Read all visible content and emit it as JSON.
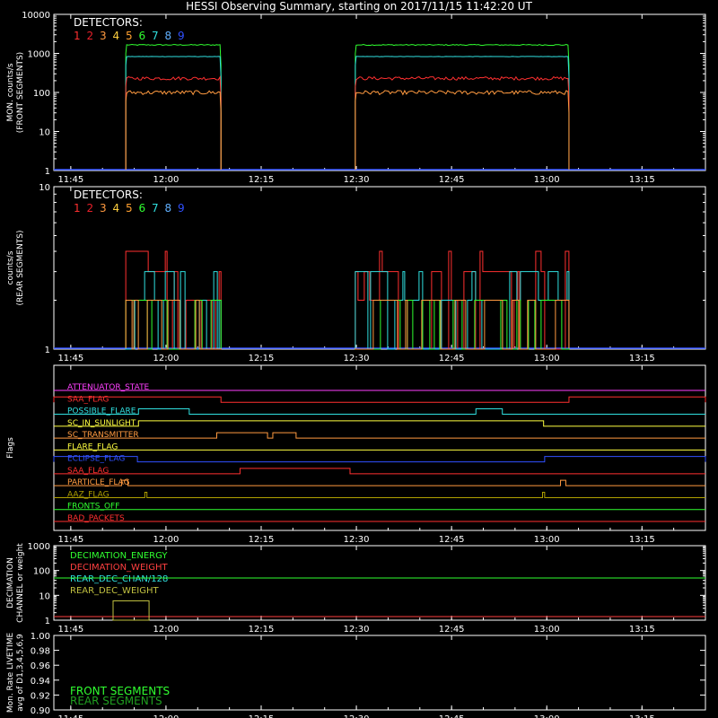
{
  "chart_data": {
    "title": "HESSI Observing Summary, starting on 2017/11/15 11:42:20 UT",
    "time_range": [
      "11:42:20",
      "13:25:00"
    ],
    "time_ticks": [
      "11:45",
      "12:00",
      "12:15",
      "12:30",
      "12:45",
      "13:00",
      "13:15"
    ],
    "detector_colors": [
      "#ff3030",
      "#e8202a",
      "#ff9a40",
      "#ffd040",
      "#ffa030",
      "#30ff30",
      "#30e0e0",
      "#60b0ff",
      "#3050ff"
    ],
    "panels": [
      {
        "id": "front",
        "type": "line",
        "ylabel": "MON. counts/s\n(FRONT SEGMENTS)",
        "log": true,
        "ylim": [
          1,
          10000
        ],
        "ytick_labels": [
          "1",
          "10",
          "100",
          "1000",
          "10000"
        ],
        "legend_title": "DETECTORS:",
        "legend_digits": [
          "1",
          "2",
          "3",
          "4",
          "5",
          "6",
          "7",
          "8",
          "9"
        ],
        "series": [
          {
            "color": "#30ff30",
            "base": 1650,
            "noise": 0.03,
            "segments": [
              [
                "11:53:40",
                "12:08:40"
              ],
              [
                "12:29:50",
                "13:03:30"
              ]
            ]
          },
          {
            "color": "#30e0e0",
            "base": 830,
            "noise": 0.01,
            "segments": [
              [
                "11:53:40",
                "12:08:40"
              ],
              [
                "12:29:50",
                "13:03:30"
              ]
            ]
          },
          {
            "color": "#ff3030",
            "base": 230,
            "noise": 0.1,
            "segments": [
              [
                "11:53:40",
                "12:08:40"
              ],
              [
                "12:29:50",
                "13:03:30"
              ]
            ]
          },
          {
            "color": "#ff9a40",
            "base": 100,
            "noise": 0.12,
            "segments": [
              [
                "11:53:40",
                "12:08:40"
              ],
              [
                "12:29:50",
                "13:03:30"
              ]
            ]
          }
        ]
      },
      {
        "id": "rear",
        "type": "step",
        "ylabel": "counts/s\n(REAR SEGMENTS)",
        "log": true,
        "ylim": [
          1,
          10
        ],
        "ytick_labels": [
          "1",
          "10"
        ],
        "legend_title": "DETECTORS:",
        "legend_digits": [
          "1",
          "2",
          "3",
          "4",
          "5",
          "6",
          "7",
          "8",
          "9"
        ],
        "series": [
          {
            "color": "#ff3030",
            "levels": [
              1,
              2,
              3,
              4
            ],
            "segments": [
              [
                "11:53:40",
                "12:08:40"
              ],
              [
                "12:29:50",
                "13:03:30"
              ]
            ]
          },
          {
            "color": "#30e0e0",
            "levels": [
              1,
              2,
              3
            ],
            "segments": [
              [
                "11:53:40",
                "12:08:40"
              ],
              [
                "12:29:50",
                "13:03:30"
              ]
            ]
          },
          {
            "color": "#30ff30",
            "levels": [
              1,
              2
            ],
            "segments": [
              [
                "11:53:40",
                "12:08:40"
              ],
              [
                "12:29:50",
                "13:03:30"
              ]
            ]
          },
          {
            "color": "#ff9a40",
            "levels": [
              1,
              2
            ],
            "segments": [
              [
                "11:53:40",
                "12:08:40"
              ],
              [
                "12:29:50",
                "13:03:30"
              ]
            ]
          }
        ]
      },
      {
        "id": "flags",
        "type": "flags",
        "ylabel": "Flags",
        "flags": [
          {
            "name": "ATTENUATOR_STATE",
            "color": "#ff40ff",
            "on": []
          },
          {
            "name": "SAA_FLAG",
            "color": "#ff3030",
            "on": [
              [
                "11:42:20",
                "12:08:40"
              ],
              [
                "13:03:30",
                "13:25:00"
              ]
            ]
          },
          {
            "name": "POSSIBLE_FLARE",
            "color": "#30e0e0",
            "on": [
              [
                "11:55:40",
                "12:03:40"
              ],
              [
                "12:48:50",
                "12:53:00"
              ]
            ]
          },
          {
            "name": "SC_IN_SUNLIGHT",
            "color": "#ffff40",
            "on": [
              [
                "11:55:40",
                "12:59:30"
              ]
            ]
          },
          {
            "name": "SC_TRANSMITTER",
            "color": "#ff9a40",
            "on": [
              [
                "12:08:00",
                "12:16:00"
              ],
              [
                "12:16:50",
                "12:20:30"
              ]
            ]
          },
          {
            "name": "FLARE_FLAG",
            "color": "#ffff40",
            "on": []
          },
          {
            "name": "ECLIPSE_FLAG",
            "color": "#3050ff",
            "on": [
              [
                "11:42:20",
                "11:55:30"
              ],
              [
                "12:59:40",
                "13:25:00"
              ]
            ]
          },
          {
            "name": "SAA_FLAG",
            "color": "#ff3030",
            "on": [
              [
                "12:11:40",
                "12:29:00"
              ]
            ]
          },
          {
            "name": "PARTICLE_FLAG",
            "color": "#ff9a40",
            "on": [
              [
                "11:53:00",
                "11:54:00"
              ],
              [
                "13:02:10",
                "13:03:00"
              ]
            ]
          },
          {
            "name": "AAZ_FLAG",
            "color": "#b0a000",
            "on": [
              [
                "11:56:40",
                "11:57:00"
              ],
              [
                "12:59:20",
                "12:59:40"
              ]
            ]
          },
          {
            "name": "FRONTS_OFF",
            "color": "#30ff30",
            "on": []
          },
          {
            "name": "BAD_PACKETS",
            "color": "#ff3030",
            "on": []
          }
        ]
      },
      {
        "id": "decimation",
        "type": "line",
        "ylabel": "DECIMATION\nCHANNEL or weight",
        "log": true,
        "ylim": [
          1,
          1000
        ],
        "ytick_labels": [
          "1",
          "10",
          "100",
          "1000"
        ],
        "legend": [
          {
            "name": "DECIMATION_ENERGY",
            "color": "#30ff30"
          },
          {
            "name": "DECIMATION_WEIGHT",
            "color": "#ff4040"
          },
          {
            "name": "REAR_DEC_CHAN/128",
            "color": "#30e0e0"
          },
          {
            "name": "REAR_DEC_WEIGHT",
            "color": "#c0c040"
          }
        ],
        "series": [
          {
            "name": "DECIMATION_ENERGY",
            "color": "#30ff30",
            "value": 50
          },
          {
            "name": "DECIMATION_WEIGHT",
            "color": "#ff4040",
            "value": 1.4
          },
          {
            "name": "REAR_DEC_WEIGHT",
            "color": "#c0c040",
            "box": [
              "11:51:40",
              "11:57:20",
              1,
              6
            ]
          }
        ]
      },
      {
        "id": "livetime",
        "type": "line",
        "ylabel": "Mon. Rate LIVETIME\navg of D1,3,4,5,6,9",
        "log": false,
        "ylim": [
          0.9,
          1.0
        ],
        "ytick_labels": [
          "0.90",
          "0.92",
          "0.94",
          "0.96",
          "0.98",
          "1.00"
        ],
        "legend": [
          {
            "name": "FRONT SEGMENTS",
            "color": "#30ff30"
          },
          {
            "name": "REAR SEGMENTS",
            "color": "#20a020"
          }
        ]
      }
    ]
  }
}
